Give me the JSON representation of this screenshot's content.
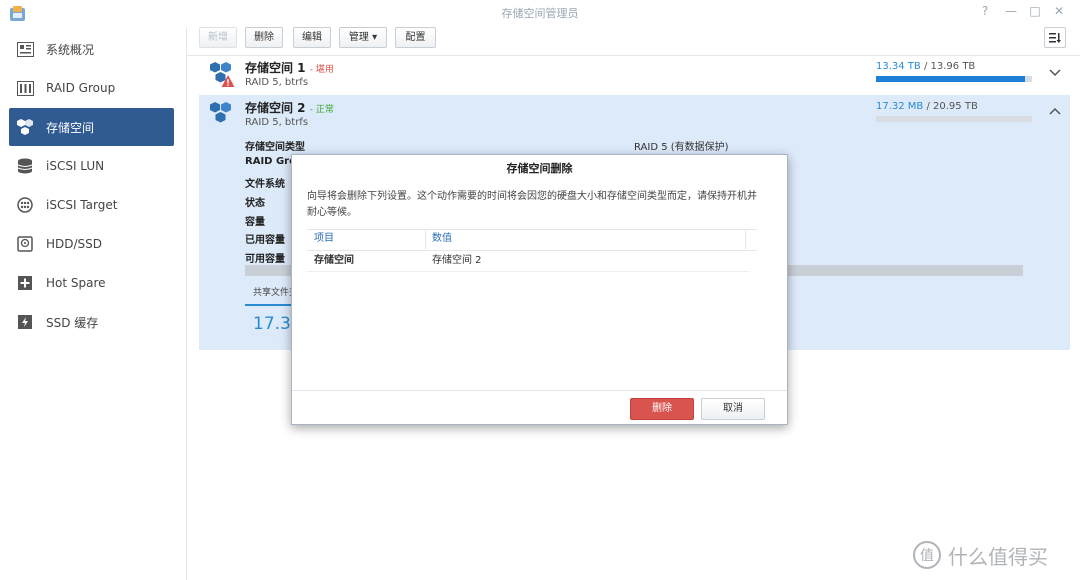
{
  "window": {
    "title": "存储空间管理员",
    "help": "?",
    "minimize": "—",
    "maximize": "□",
    "close": "✕"
  },
  "sidebar": {
    "items": [
      {
        "label": "系统概况",
        "icon": "overview-icon"
      },
      {
        "label": "RAID Group",
        "icon": "raid-group-icon"
      },
      {
        "label": "存储空间",
        "icon": "storage-pool-icon",
        "active": true
      },
      {
        "label": "iSCSI LUN",
        "icon": "iscsi-lun-icon"
      },
      {
        "label": "iSCSI Target",
        "icon": "iscsi-target-icon"
      },
      {
        "label": "HDD/SSD",
        "icon": "hdd-icon"
      },
      {
        "label": "Hot Spare",
        "icon": "hot-spare-icon"
      },
      {
        "label": "SSD 缓存",
        "icon": "ssd-cache-icon"
      }
    ]
  },
  "toolbar": {
    "new": "新增",
    "delete": "删除",
    "edit": "编辑",
    "manage": "管理 ▾",
    "config": "配置"
  },
  "pools": [
    {
      "name": "存储空间 1",
      "status": "- 堪用",
      "status_color": "#d9534f",
      "sub": "RAID 5, btrfs",
      "used": "13.34 TB",
      "sep": " / ",
      "total": "13.96 TB",
      "usage": 0.955
    },
    {
      "name": "存储空间 2",
      "status": "- 正常",
      "status_color": "#3aa537",
      "sub": "RAID 5, btrfs",
      "used": "17.32 MB",
      "sep": " / ",
      "total": "20.95 TB",
      "usage": 0.0
    }
  ],
  "details": {
    "labels": [
      "存储空间类型",
      "RAID Gro",
      "文件系统",
      "状态",
      "容量",
      "已用容量",
      "可用容量"
    ],
    "type_value": "RAID 5 (有数据保护)",
    "shared_tab": "共享文件夹",
    "big_number": "17.3"
  },
  "dialog": {
    "title": "存储空间删除",
    "description": "向导将会删除下列设置。这个动作需要的时间将会因您的硬盘大小和存储空间类型而定，请保持开机并耐心等候。",
    "columns": [
      "项目",
      "数值"
    ],
    "rows": [
      {
        "item": "存储空间",
        "value": "存储空间 2"
      }
    ],
    "delete_button": "删除",
    "cancel_button": "取消"
  },
  "watermark": {
    "text": "什么值得买",
    "glyph": "值"
  },
  "colors": {
    "accent": "#2f5a92",
    "link_blue": "#2a8bd1",
    "danger": "#d9534f",
    "selected_row": "#ddeafa"
  }
}
